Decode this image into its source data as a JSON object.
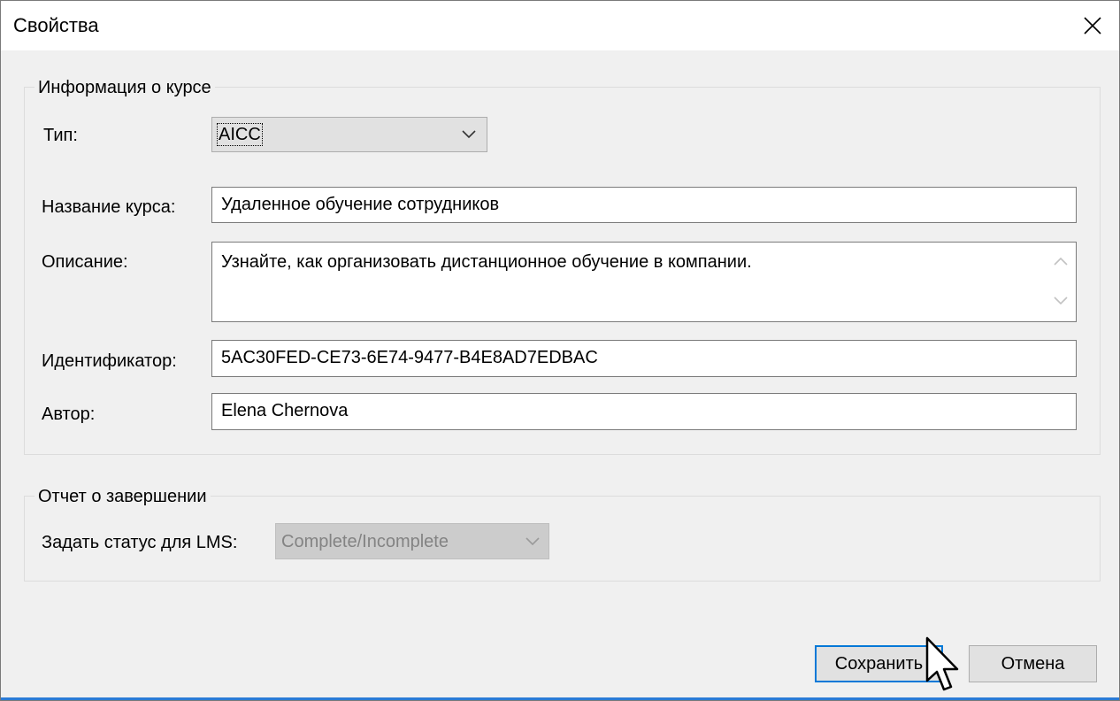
{
  "window": {
    "title": "Свойства",
    "close_icon": "close-icon"
  },
  "course_info": {
    "legend": "Информация о курсе",
    "type_label": "Тип:",
    "type_value": "AICC",
    "name_label": "Название курса:",
    "name_value": "Удаленное обучение сотрудников",
    "description_label": "Описание:",
    "description_value": "Узнайте, как организовать дистанционное обучение в компании.",
    "id_label": "Идентификатор:",
    "id_value": "5AC30FED-CE73-6E74-9477-B4E8AD7EDBAC",
    "author_label": "Автор:",
    "author_value": "Elena Chernova"
  },
  "completion": {
    "legend": "Отчет о завершении",
    "status_label": "Задать статус для LMS:",
    "status_value": "Complete/Incomplete"
  },
  "buttons": {
    "save": "Сохранить",
    "cancel": "Отмена"
  },
  "colors": {
    "accent": "#0078d7",
    "dialog_bg": "#f0f0f0"
  }
}
